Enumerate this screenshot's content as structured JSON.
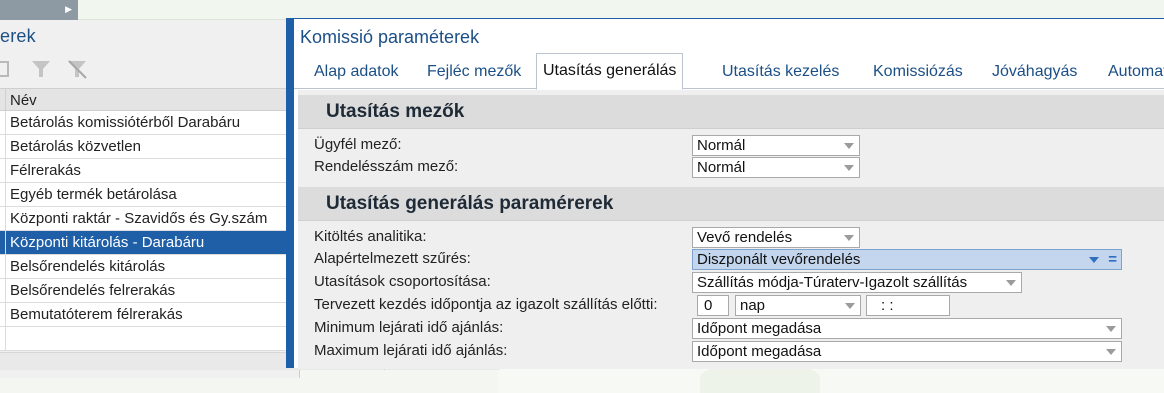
{
  "left_panel": {
    "title": "erek",
    "column_header": "Név",
    "rows": [
      "Betárolás komissiótérből Darabáru",
      "Betárolás közvetlen",
      "Félrerakás",
      "Egyéb termék betárolása",
      "Központi raktár - Szavidős és Gy.szám",
      "Központi kitárolás - Darabáru",
      "Belsőrendelés kitárolás",
      "Belsőrendelés felrerakás",
      "Bemutatóterem félrerakás",
      ""
    ],
    "selected_index": 5
  },
  "dialog": {
    "title": "Komissió paraméterek",
    "tabs": [
      "Alap adatok",
      "Fejléc mezők",
      "Utasítás generálás",
      "Utasítás kezelés",
      "Komissiózás",
      "Jóváhagyás",
      "Automat"
    ],
    "active_tab": 2,
    "section1": {
      "title": "Utasítás mezők",
      "fields": [
        {
          "label": "Ügyfél mező:",
          "value": "Normál"
        },
        {
          "label": "Rendelésszám mező:",
          "value": "Normál"
        }
      ]
    },
    "section2": {
      "title": "Utasítás generálás paramérerek",
      "fields": [
        {
          "label": "Kitöltés analitika:",
          "value": "Vevő rendelés"
        },
        {
          "label": "Alapértelmezett szűrés:",
          "value": "Diszponált vevőrendelés"
        },
        {
          "label": "Utasítások csoportosítása:",
          "value": "Szállítás módja-Túraterv-Igazolt szállítás"
        },
        {
          "label": "Tervezett kezdés időpontja az igazolt szállítás előtti:",
          "number": "0",
          "unit": "nap",
          "time": " :  :"
        },
        {
          "label": "Minimum lejárati idő ajánlás:",
          "value": "Időpont megadása"
        },
        {
          "label": "Maximum lejárati idő ajánlás:",
          "value": "Időpont megadása"
        }
      ]
    }
  },
  "colors": {
    "accent": "#1f5fa8",
    "title_blue": "#1b4f86",
    "highlight": "#c3d6ee"
  }
}
